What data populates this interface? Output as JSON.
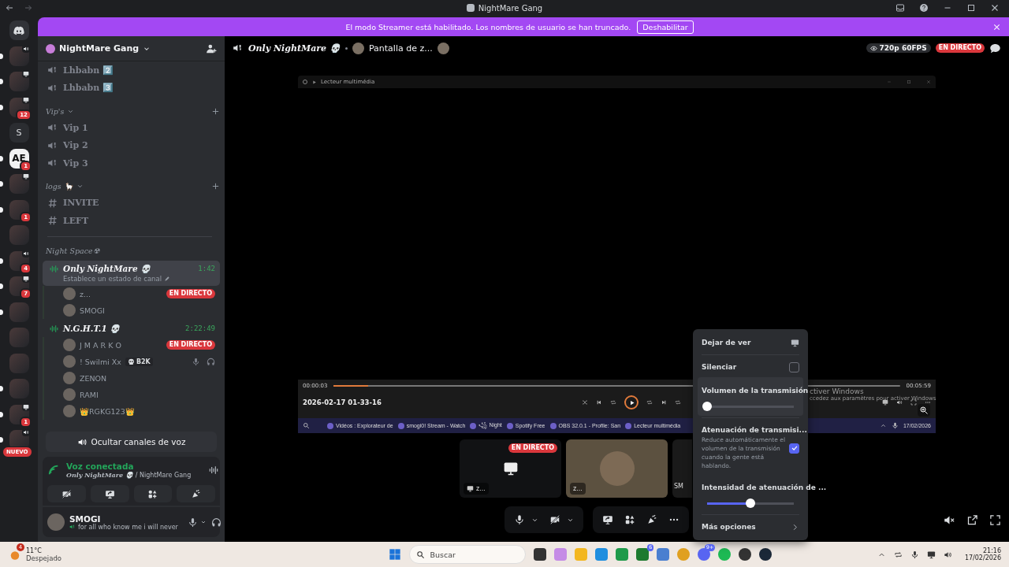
{
  "titlebar": {
    "title": "NightMare Gang"
  },
  "servers": [
    {
      "kind": "home",
      "unread": false,
      "voice_active": false,
      "screen_active": false
    },
    {
      "kind": "photo",
      "unread": true,
      "voice_active": true,
      "screen_active": false
    },
    {
      "kind": "photo",
      "unread": true,
      "voice_active": false,
      "screen_active": true
    },
    {
      "kind": "photo",
      "unread": true,
      "voice_active": false,
      "screen_active": true,
      "badge": "12"
    },
    {
      "kind": "letter",
      "text": "S",
      "unread": false,
      "voice_active": false,
      "screen_active": false
    },
    {
      "kind": "logo",
      "text": "AE",
      "unread": true,
      "voice_active": false,
      "screen_active": false,
      "badge": "1"
    },
    {
      "kind": "photo",
      "unread": true,
      "voice_active": false,
      "screen_active": true
    },
    {
      "kind": "photo",
      "unread": true,
      "voice_active": false,
      "screen_active": false,
      "badge": "1"
    },
    {
      "kind": "photo",
      "unread": false,
      "voice_active": false,
      "screen_active": false
    },
    {
      "kind": "photo",
      "unread": true,
      "voice_active": true,
      "screen_active": false,
      "badge": "4"
    },
    {
      "kind": "photo",
      "unread": true,
      "voice_active": false,
      "screen_active": true,
      "badge": "7"
    },
    {
      "kind": "photo",
      "unread": true,
      "voice_active": false,
      "screen_active": false
    },
    {
      "kind": "photo",
      "unread": false,
      "voice_active": false,
      "screen_active": false
    },
    {
      "kind": "photo",
      "unread": false,
      "voice_active": false,
      "screen_active": false
    },
    {
      "kind": "photo",
      "unread": true,
      "voice_active": false,
      "screen_active": false
    },
    {
      "kind": "photo",
      "unread": true,
      "voice_active": false,
      "screen_active": true,
      "badge": "1"
    },
    {
      "kind": "photo",
      "unread": true,
      "voice_active": true,
      "screen_active": false,
      "label": "NUEVO"
    }
  ],
  "banner": {
    "text": "El modo Streamer está habilitado. Los nombres de usuario se han truncado.",
    "button": "Deshabilitar"
  },
  "sidebar": {
    "server_name": "NightMare Gang",
    "items": [
      {
        "kind": "voice",
        "name": "Lhbabn 2️⃣"
      },
      {
        "kind": "voice",
        "name": "Lhbabn 3️⃣"
      },
      {
        "kind": "category",
        "name": "Vip's",
        "expanded": true,
        "addable": true
      },
      {
        "kind": "voice",
        "name": "Vip 1"
      },
      {
        "kind": "voice",
        "name": "Vip 2"
      },
      {
        "kind": "voice",
        "name": "Vip 3"
      },
      {
        "kind": "category",
        "name": "logs 🦙",
        "expanded": true,
        "addable": true
      },
      {
        "kind": "text",
        "name": "INVITE"
      },
      {
        "kind": "text",
        "name": "LEFT"
      },
      {
        "kind": "divider"
      },
      {
        "kind": "category",
        "name": "Night Space☢",
        "addable": false
      },
      {
        "kind": "voice-live",
        "name": "Only NightMare 💀",
        "timer": "1:42",
        "status": "Establece un estado de canal",
        "selected": true,
        "members": [
          {
            "name": "z...",
            "badge": "EN DIRECTO",
            "muted": false,
            "deafened": false
          },
          {
            "name": "SMOGI",
            "muted": false,
            "deafened": false
          }
        ]
      },
      {
        "kind": "voice-live",
        "name": "N.G.H.T.1 💀",
        "timer": "2:22:49",
        "selected": false,
        "members": [
          {
            "name": "J M A R K O",
            "badge": "EN DIRECTO",
            "muted": false,
            "deafened": false
          },
          {
            "name": "! Swilmi Xx",
            "tag": "B2K",
            "muted": true,
            "deafened": true
          },
          {
            "name": "ZENON",
            "muted": false,
            "deafened": false
          },
          {
            "name": "RAMI",
            "muted": false,
            "deafened": false
          },
          {
            "name": "👑RGKG123👑",
            "muted": false,
            "deafened": false
          }
        ]
      }
    ],
    "hide_button": "Ocultar canales de voz",
    "voice_panel": {
      "status": "Voz conectada",
      "channel": "Only NightMare 💀",
      "server": "/ NightMare Gang"
    },
    "user": {
      "name": "SMOGI",
      "status": "for all who know me i will never"
    }
  },
  "stream": {
    "channel": "Only NightMare 💀",
    "title": "Pantalla de z...",
    "quality": "720p 60FPS",
    "live": "EN DIRECTO",
    "inner_screen": {
      "window_title": "Lecteur multimédia",
      "elapsed": "00:00:03",
      "duration": "00:05:59",
      "level": 0.06,
      "media_title": "2026-02-17 01-33-16",
      "watermark_title": "ctiver Windows",
      "watermark_text": "ccedez aux paramètres pour activer Windows",
      "taskbar_items": [
        "Vidéos : Explorateur de",
        "smogi0! Stream - Watch",
        "꧁ Night",
        "Spotify Free",
        "OBS 32.0.1 - Profile: San",
        "Lecteur multimédia"
      ],
      "date": "17/02/2026"
    },
    "tiles": [
      {
        "kind": "screen",
        "name": "z...",
        "badge": "EN DIRECTO"
      },
      {
        "kind": "avatar",
        "name": "z..."
      },
      {
        "kind": "partial",
        "name": "SM"
      }
    ]
  },
  "menu": [
    {
      "kind": "action",
      "label": "Dejar de ver"
    },
    {
      "kind": "checkbox",
      "label": "Silenciar",
      "checked": false
    },
    {
      "kind": "slider",
      "label": "Volumen de la transmisión",
      "level": 0.0
    },
    {
      "kind": "checkbox",
      "label": "Atenuación de transmisi...",
      "description": "Reduce automáticamente el volumen de la transmisión cuando la gente está hablando.",
      "checked": true
    },
    {
      "kind": "slider",
      "label": "Intensidad de atenuación de ...",
      "level": 0.5
    },
    {
      "kind": "submenu",
      "label": "Más opciones"
    }
  ],
  "taskbar": {
    "temperature": "11°C",
    "weather": "Despejado",
    "weather_badge": "4",
    "search": "Buscar",
    "xbox_badge": "6",
    "discord_badge": "9+",
    "time": "21:16",
    "date": "17/02/2026"
  }
}
